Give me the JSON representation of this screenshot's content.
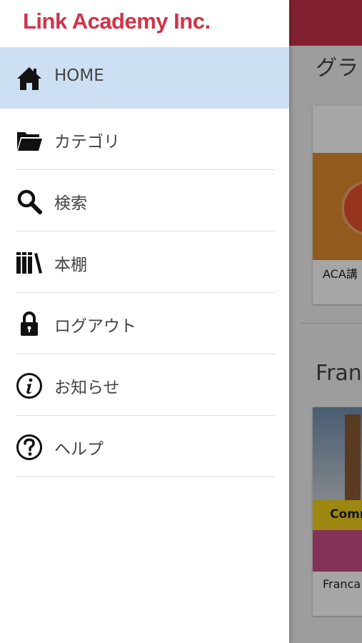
{
  "app": {
    "logo": "Link Academy Inc."
  },
  "drawer": {
    "items": [
      {
        "label": "HOME",
        "icon": "home-icon",
        "active": true
      },
      {
        "label": "カテゴリ",
        "icon": "folder-icon"
      },
      {
        "label": "検索",
        "icon": "search-icon"
      },
      {
        "label": "本棚",
        "icon": "bookshelf-icon"
      },
      {
        "label": "ログアウト",
        "icon": "lock-icon"
      },
      {
        "label": "お知らせ",
        "icon": "info-icon"
      },
      {
        "label": "ヘルプ",
        "icon": "help-icon"
      }
    ]
  },
  "background": {
    "section1_title": "グラ",
    "card1_caption": "ACA講",
    "section2_title": "Fran",
    "card2_banner": "Comm",
    "card2_caption": "Franca"
  },
  "colors": {
    "accent": "#d0334a",
    "active_bg": "#cddff3",
    "topbar": "#c8354b"
  }
}
